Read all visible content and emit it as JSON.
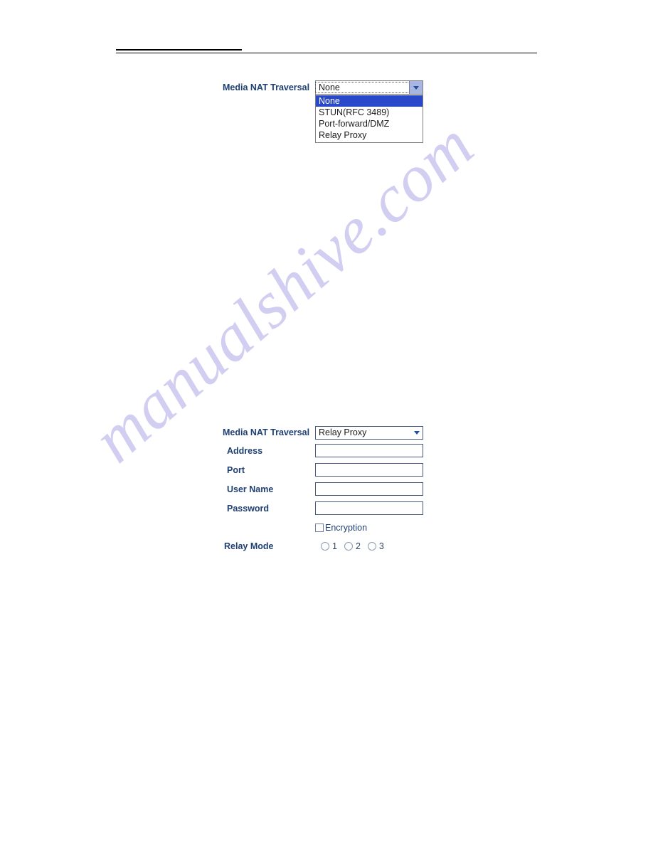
{
  "page": {
    "background_color": "#ffffff",
    "label_color": "#1f3f73",
    "highlight_color": "#2a49c8",
    "border_color": "#44587c"
  },
  "watermark": {
    "text": "manualshive.com",
    "color": "#c9c6f0"
  },
  "form_open": {
    "label": "Media NAT Traversal",
    "selected_value": "None",
    "arrow_icon": "chevron-down-icon",
    "options": [
      "None",
      "STUN(RFC 3489)",
      "Port-forward/DMZ",
      "Relay Proxy"
    ]
  },
  "form_relay": {
    "nat_label": "Media NAT Traversal",
    "nat_value": "Relay Proxy",
    "arrow_icon": "chevron-down-icon",
    "fields": [
      {
        "label": "Address",
        "value": ""
      },
      {
        "label": "Port",
        "value": ""
      },
      {
        "label": "User Name",
        "value": ""
      },
      {
        "label": "Password",
        "value": ""
      }
    ],
    "encryption": {
      "label": "Encryption",
      "checked": false
    },
    "relay_mode": {
      "label": "Relay Mode",
      "options": [
        "1",
        "2",
        "3"
      ],
      "selected": ""
    }
  }
}
